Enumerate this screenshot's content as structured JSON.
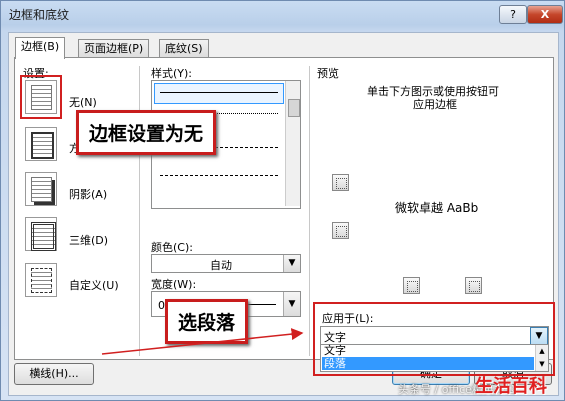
{
  "window": {
    "title": "边框和底纹",
    "help_label": "?",
    "close_label": "X"
  },
  "tabs": [
    {
      "label": "边框(B)",
      "active": true
    },
    {
      "label": "页面边框(P)",
      "active": false
    },
    {
      "label": "底纹(S)",
      "active": false
    }
  ],
  "settings": {
    "header": "设置:",
    "items": [
      {
        "label": "无(N)",
        "icon": "border-none-icon"
      },
      {
        "label": "方框(X)",
        "icon": "border-box-icon"
      },
      {
        "label": "阴影(A)",
        "icon": "border-shadow-icon"
      },
      {
        "label": "三维(D)",
        "icon": "border-3d-icon"
      },
      {
        "label": "自定义(U)",
        "icon": "border-custom-icon"
      }
    ]
  },
  "style": {
    "header": "样式(Y):"
  },
  "color": {
    "label": "颜色(C):",
    "value": "自动"
  },
  "width": {
    "label": "宽度(W):",
    "value": "0.5 磅"
  },
  "preview": {
    "header": "预览",
    "hint_line1": "单击下方图示或使用按钮可",
    "hint_line2": "应用边框",
    "sample_text": "微软卓越  AaBb"
  },
  "apply_to": {
    "label": "应用于(L):",
    "value": "文字",
    "options": [
      "文字",
      "段落"
    ]
  },
  "buttons": {
    "horizontal_line": "横线(H)...",
    "ok": "确定",
    "cancel": "取消"
  },
  "annotations": {
    "callout_border": "边框设置为无",
    "callout_paragraph": "选段落",
    "accent_color": "#d12020"
  },
  "watermark": {
    "source": "头条号 / office精英办公",
    "brand": "生活百科"
  }
}
